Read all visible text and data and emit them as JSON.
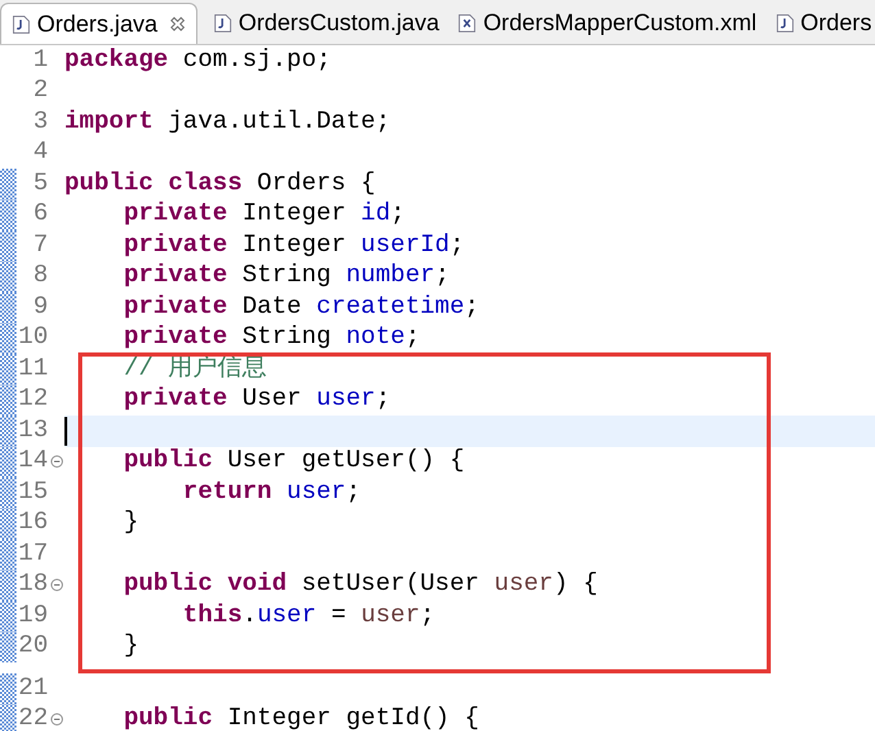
{
  "tabs": [
    {
      "label": "Orders.java",
      "kind": "java",
      "selected": true,
      "closable": true
    },
    {
      "label": "OrdersCustom.java",
      "kind": "java",
      "selected": false,
      "closable": false
    },
    {
      "label": "OrdersMapperCustom.xml",
      "kind": "xml",
      "selected": false,
      "closable": false
    },
    {
      "label": "Orders",
      "kind": "java",
      "selected": false,
      "closable": false
    }
  ],
  "blocks": [
    {
      "kind": "plain",
      "lines": [
        {
          "number": "1",
          "changed": false,
          "foldable": false,
          "current": false,
          "tokens": [
            {
              "kind": "keyword",
              "text": "package"
            },
            {
              "kind": "plain",
              "text": " com.sj.po;"
            }
          ]
        },
        {
          "number": "2",
          "changed": false,
          "foldable": false,
          "current": false
        },
        {
          "number": "3",
          "changed": false,
          "foldable": false,
          "current": false,
          "tokens": [
            {
              "kind": "keyword",
              "text": "import"
            },
            {
              "kind": "plain",
              "text": " java.util.Date;"
            }
          ]
        },
        {
          "number": "4",
          "changed": false,
          "foldable": false,
          "current": false
        },
        {
          "number": "5",
          "changed": true,
          "foldable": false,
          "current": false,
          "tokens": [
            {
              "kind": "keyword",
              "text": "public class"
            },
            {
              "kind": "plain",
              "text": " Orders {"
            }
          ]
        },
        {
          "number": "6",
          "changed": true,
          "foldable": false,
          "current": false,
          "tokens": [
            {
              "kind": "keyword",
              "text": "    private"
            },
            {
              "kind": "plain",
              "text": " Integer "
            },
            {
              "kind": "field",
              "text": "id"
            },
            {
              "kind": "plain",
              "text": ";"
            }
          ]
        },
        {
          "number": "7",
          "changed": true,
          "foldable": false,
          "current": false,
          "tokens": [
            {
              "kind": "keyword",
              "text": "    private"
            },
            {
              "kind": "plain",
              "text": " Integer "
            },
            {
              "kind": "field",
              "text": "userId"
            },
            {
              "kind": "plain",
              "text": ";"
            }
          ]
        },
        {
          "number": "8",
          "changed": true,
          "foldable": false,
          "current": false,
          "tokens": [
            {
              "kind": "keyword",
              "text": "    private"
            },
            {
              "kind": "plain",
              "text": " String "
            },
            {
              "kind": "field",
              "text": "number"
            },
            {
              "kind": "plain",
              "text": ";"
            }
          ]
        },
        {
          "number": "9",
          "changed": true,
          "foldable": false,
          "current": false,
          "tokens": [
            {
              "kind": "keyword",
              "text": "    private"
            },
            {
              "kind": "plain",
              "text": " Date "
            },
            {
              "kind": "field",
              "text": "createtime"
            },
            {
              "kind": "plain",
              "text": ";"
            }
          ]
        },
        {
          "number": "10",
          "changed": true,
          "foldable": false,
          "current": false,
          "tokens": [
            {
              "kind": "keyword",
              "text": "    private"
            },
            {
              "kind": "plain",
              "text": " String "
            },
            {
              "kind": "field",
              "text": "note"
            },
            {
              "kind": "plain",
              "text": ";"
            }
          ]
        }
      ]
    },
    {
      "kind": "boxed",
      "lines": [
        {
          "number": "11",
          "changed": true,
          "foldable": false,
          "current": false,
          "tokens": [
            {
              "kind": "comment",
              "text": "    // 用户信息"
            }
          ]
        },
        {
          "number": "12",
          "changed": true,
          "foldable": false,
          "current": false,
          "tokens": [
            {
              "kind": "keyword",
              "text": "    private"
            },
            {
              "kind": "plain",
              "text": " User "
            },
            {
              "kind": "field",
              "text": "user"
            },
            {
              "kind": "plain",
              "text": ";"
            }
          ]
        },
        {
          "number": "13",
          "changed": true,
          "foldable": false,
          "current": true
        },
        {
          "number": "14",
          "changed": true,
          "foldable": true,
          "current": false,
          "tokens": [
            {
              "kind": "keyword",
              "text": "    public"
            },
            {
              "kind": "plain",
              "text": " User getUser() {"
            }
          ]
        },
        {
          "number": "15",
          "changed": true,
          "foldable": false,
          "current": false,
          "tokens": [
            {
              "kind": "keyword",
              "text": "        return "
            },
            {
              "kind": "field",
              "text": "user"
            },
            {
              "kind": "plain",
              "text": ";"
            }
          ]
        },
        {
          "number": "16",
          "changed": true,
          "foldable": false,
          "current": false,
          "tokens": [
            {
              "kind": "plain",
              "text": "    }"
            }
          ]
        },
        {
          "number": "17",
          "changed": true,
          "foldable": false,
          "current": false
        },
        {
          "number": "18",
          "changed": true,
          "foldable": true,
          "current": false,
          "tokens": [
            {
              "kind": "keyword",
              "text": "    public void"
            },
            {
              "kind": "plain",
              "text": " setUser(User "
            },
            {
              "kind": "param",
              "text": "user"
            },
            {
              "kind": "plain",
              "text": ") {"
            }
          ]
        },
        {
          "number": "19",
          "changed": true,
          "foldable": false,
          "current": false,
          "tokens": [
            {
              "kind": "keyword",
              "text": "        this"
            },
            {
              "kind": "plain",
              "text": "."
            },
            {
              "kind": "field",
              "text": "user"
            },
            {
              "kind": "plain",
              "text": " = "
            },
            {
              "kind": "param",
              "text": "user"
            },
            {
              "kind": "plain",
              "text": ";"
            }
          ]
        },
        {
          "number": "20",
          "changed": true,
          "foldable": false,
          "current": false,
          "tokens": [
            {
              "kind": "plain",
              "text": "    }"
            }
          ]
        }
      ]
    },
    {
      "kind": "plain",
      "lines": [
        {
          "number": "21",
          "changed": true,
          "foldable": false,
          "current": false
        },
        {
          "number": "22",
          "changed": true,
          "foldable": true,
          "current": false,
          "tokens": [
            {
              "kind": "keyword",
              "text": "    public"
            },
            {
              "kind": "plain",
              "text": " Integer getId() {"
            }
          ]
        }
      ]
    }
  ]
}
